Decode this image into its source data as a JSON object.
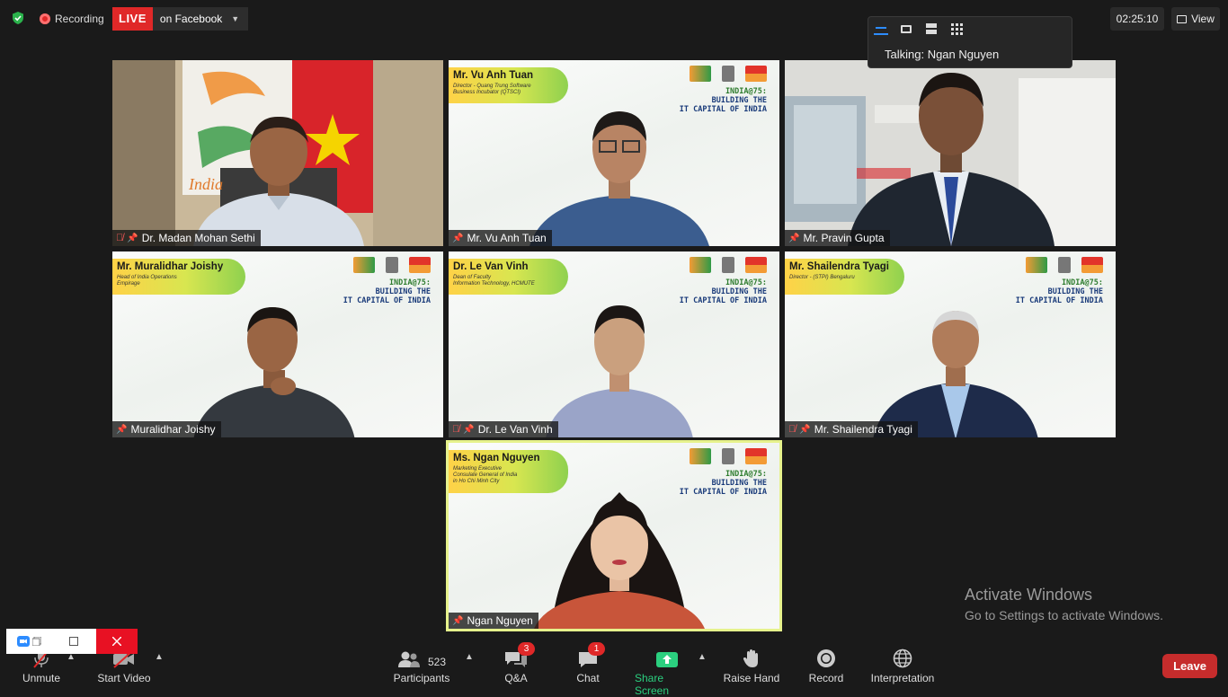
{
  "topbar": {
    "recording_label": "Recording",
    "live_label": "LIVE",
    "live_destination": "on Facebook",
    "timer": "02:25:10",
    "view_label": "View"
  },
  "talking_popup": {
    "text": "Talking: Ngan Nguyen"
  },
  "banner_theme": {
    "line1": "INDIA@75:",
    "line2": "BUILDING THE",
    "line3": "IT CAPITAL OF INDIA"
  },
  "tiles": [
    {
      "name": "Dr. Madan Mohan Sethi",
      "muted": true
    },
    {
      "name": "Mr. Vu Anh Tuan",
      "muted": false,
      "badge_name": "Mr. Vu Anh Tuan",
      "badge_role": "Director - Quang Trung Software\nBusiness Incubator (QTSCI)"
    },
    {
      "name": "Mr. Pravin Gupta",
      "muted": false
    },
    {
      "name": "Muralidhar Joishy",
      "muted": false,
      "badge_name": "Mr. Muralidhar Joishy",
      "badge_role": "Head of India Operations\nEmpirage"
    },
    {
      "name": "Dr. Le Van Vinh",
      "muted": true,
      "badge_name": "Dr. Le Van Vinh",
      "badge_role": "Dean of Faculty\nInformation Technology, HCMUTE"
    },
    {
      "name": "Mr. Shailendra Tyagi",
      "muted": true,
      "badge_name": "Mr. Shailendra Tyagi",
      "badge_role": "Director - (STPI) Bengaluru"
    },
    {
      "name": "Ngan Nguyen",
      "muted": false,
      "badge_name": "Ms. Ngan Nguyen",
      "badge_role": "Marketing Executive\nConsulate General of India\nin Ho Chi Minh City"
    }
  ],
  "tile1_bg_text": "India",
  "activate": {
    "line1": "Activate Windows",
    "line2": "Go to Settings to activate Windows."
  },
  "toolbar": {
    "unmute": "Unmute",
    "start_video": "Start Video",
    "participants": "Participants",
    "participant_count": "523",
    "qa": "Q&A",
    "qa_count": "3",
    "chat": "Chat",
    "chat_count": "1",
    "share_screen": "Share Screen",
    "raise_hand": "Raise Hand",
    "record": "Record",
    "interpretation": "Interpretation",
    "leave": "Leave"
  },
  "colors": {
    "live_red": "#e02828",
    "share_green": "#2bd07f",
    "active_speaker": "#e6f28c",
    "leave_red": "#c62c2c"
  }
}
